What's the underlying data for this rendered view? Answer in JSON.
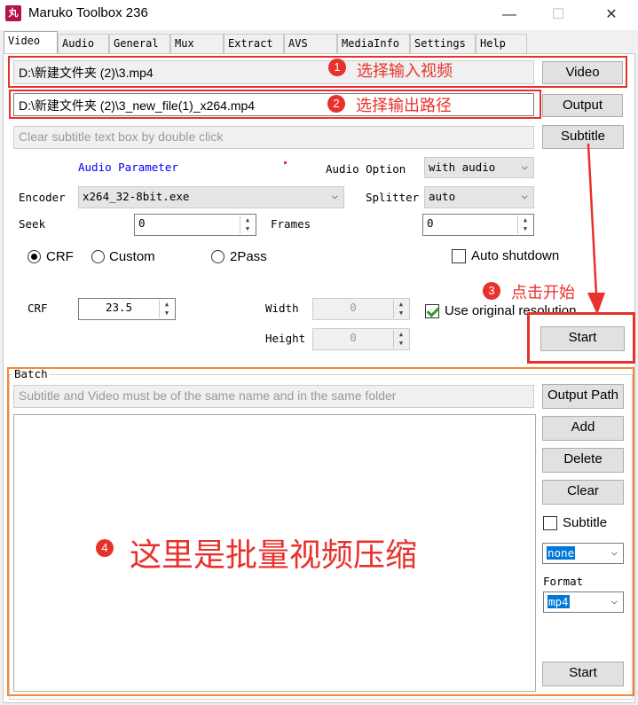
{
  "window": {
    "title": "Maruko Toolbox 236",
    "icon": "app-icon",
    "icon_glyph": "丸",
    "minimize_glyph": "—",
    "maximize_glyph": "☐",
    "close_glyph": "✕"
  },
  "tabs": [
    "Video",
    "Audio",
    "General",
    "Mux",
    "Extract",
    "AVS",
    "MediaInfo",
    "Settings",
    "Help"
  ],
  "active_tab": "Video",
  "video": {
    "input_path": "D:\\新建文件夹 (2)\\3.mp4",
    "video_button": "Video",
    "output_path": "D:\\新建文件夹 (2)\\3_new_file(1)_x264.mp4",
    "output_button": "Output",
    "subtitle_placeholder": "Clear subtitle text box by double click",
    "subtitle_button": "Subtitle",
    "audio_parameter_link": "Audio Parameter",
    "audio_option_label": "Audio Option",
    "audio_option_value": "with audio",
    "encoder_label": "Encoder",
    "encoder_value": "x264_32-8bit.exe",
    "splitter_label": "Splitter",
    "splitter_value": "auto",
    "seek_label": "Seek",
    "seek_value": "0",
    "frames_label": "Frames",
    "frames_value": "0",
    "mode_crf": "CRF",
    "mode_custom": "Custom",
    "mode_2pass": "2Pass",
    "selected_mode": "CRF",
    "auto_shutdown_label": "Auto shutdown",
    "crf_label": "CRF",
    "crf_value": "23.5",
    "width_label": "Width",
    "width_value": "0",
    "height_label": "Height",
    "height_value": "0",
    "use_original_label": "Use original resolution",
    "use_original_checked": true,
    "start_button": "Start"
  },
  "batch": {
    "group_title": "Batch",
    "hint_placeholder": "Subtitle and Video must be of the same name and in the same folder",
    "output_path_button": "Output Path",
    "add_button": "Add",
    "delete_button": "Delete",
    "clear_button": "Clear",
    "subtitle_checkbox_label": "Subtitle",
    "subtitle_select_value": "none",
    "format_label": "Format",
    "format_select_value": "mp4",
    "start_button": "Start"
  },
  "annotations": {
    "a1_number": "1",
    "a1_text": "选择输入视频",
    "a2_number": "2",
    "a2_text": "选择输出路径",
    "a3_number": "3",
    "a3_text": "点击开始",
    "a4_number": "4",
    "a4_text": "这里是批量视频压缩"
  },
  "colors": {
    "annotation_red": "#e8312c",
    "batch_orange": "#f08a3c",
    "link_blue": "#0000ff",
    "selection_blue": "#0078d7"
  }
}
